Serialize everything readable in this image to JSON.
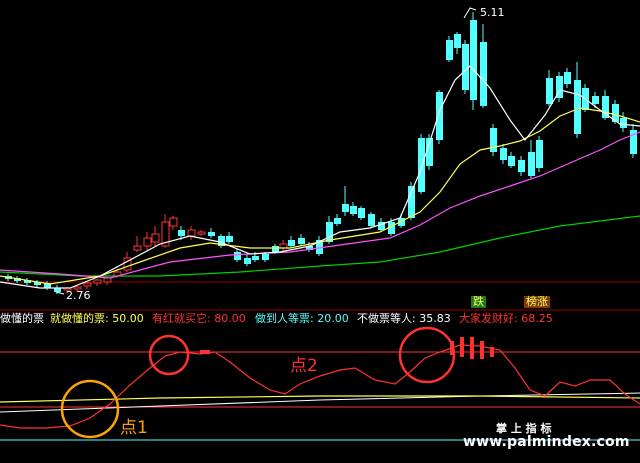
{
  "price_panel": {
    "high_label": "5.11",
    "low_label": "2.76",
    "colors": {
      "up": "#ff3232",
      "down": "#54ffff",
      "ma5": "#ffffff",
      "ma10": "#ffff54",
      "ma20": "#ff54ff",
      "ma60": "#00d000"
    }
  },
  "indicator_bar": {
    "name": "做懂的票",
    "fields": [
      {
        "label": "就做懂的票: ",
        "value": "50.00",
        "color": "#ffff54"
      },
      {
        "label": "有红就买它: ",
        "value": "80.00",
        "color": "#ff3232"
      },
      {
        "label": "做到人等票: ",
        "value": "20.00",
        "color": "#54ffff"
      },
      {
        "label": "不做票等人: ",
        "value": "35.83",
        "color": "#ffffff"
      },
      {
        "label": "大家发财好: ",
        "value": "68.25",
        "color": "#ff3232"
      }
    ]
  },
  "signal_tags": {
    "fall": "跌",
    "rise": "榜涨"
  },
  "annotations": {
    "point1": "点1",
    "point2": "点2"
  },
  "watermark": {
    "title": "掌 上 指 标",
    "url": "www.palmindex.com"
  }
}
